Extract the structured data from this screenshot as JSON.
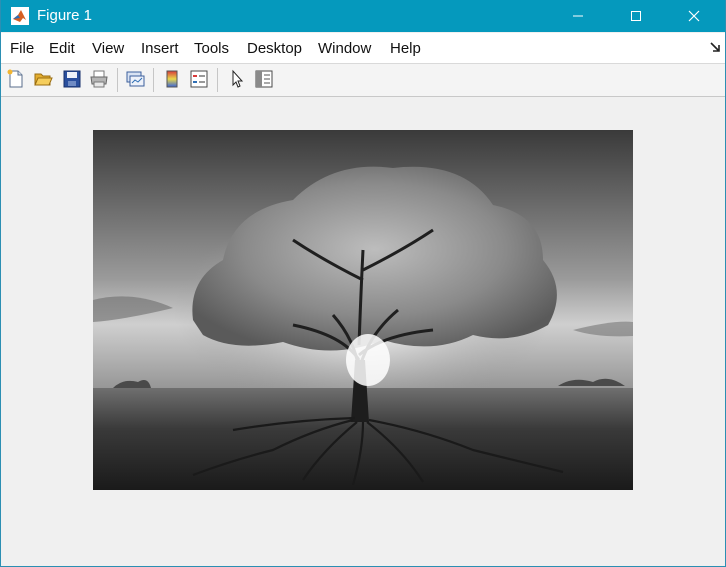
{
  "window": {
    "title": "Figure 1",
    "icon": "matlab-logo-icon",
    "controls": [
      "minimize-icon",
      "maximize-icon",
      "close-icon"
    ]
  },
  "menu": {
    "items": [
      "File",
      "Edit",
      "View",
      "Insert",
      "Tools",
      "Desktop",
      "Window",
      "Help"
    ],
    "dock_icon": "dock-arrow-icon"
  },
  "toolbar": {
    "icons": [
      "new-figure-icon",
      "open-file-icon",
      "save-icon",
      "print-icon",
      "link-plot-icon",
      "colorbar-icon",
      "legend-icon",
      "pointer-icon",
      "property-editor-icon"
    ]
  },
  "figure": {
    "image": "grayscale-tree-roots-image"
  },
  "colors": {
    "titlebar": "#0599bd",
    "figure_background": "#f0f0f0"
  }
}
